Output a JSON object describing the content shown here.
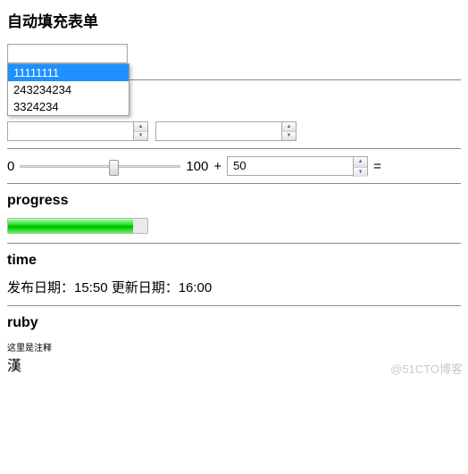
{
  "heading": "自动填充表单",
  "autofill": {
    "value": "",
    "options": [
      "11111111",
      "243234234",
      "3324234"
    ],
    "selected_index": 0
  },
  "spinner1": {
    "value": ""
  },
  "spinner2": {
    "value": ""
  },
  "slider": {
    "min_label": "0",
    "max_label": "100",
    "plus": "+",
    "number_value": "50",
    "equals": "="
  },
  "progress": {
    "heading": "progress"
  },
  "time": {
    "heading": "time",
    "text": "发布日期：15:50 更新日期：16:00"
  },
  "ruby": {
    "heading": "ruby",
    "annotation": "这里是注释",
    "base": "漢"
  },
  "watermark": "@51CTO博客"
}
